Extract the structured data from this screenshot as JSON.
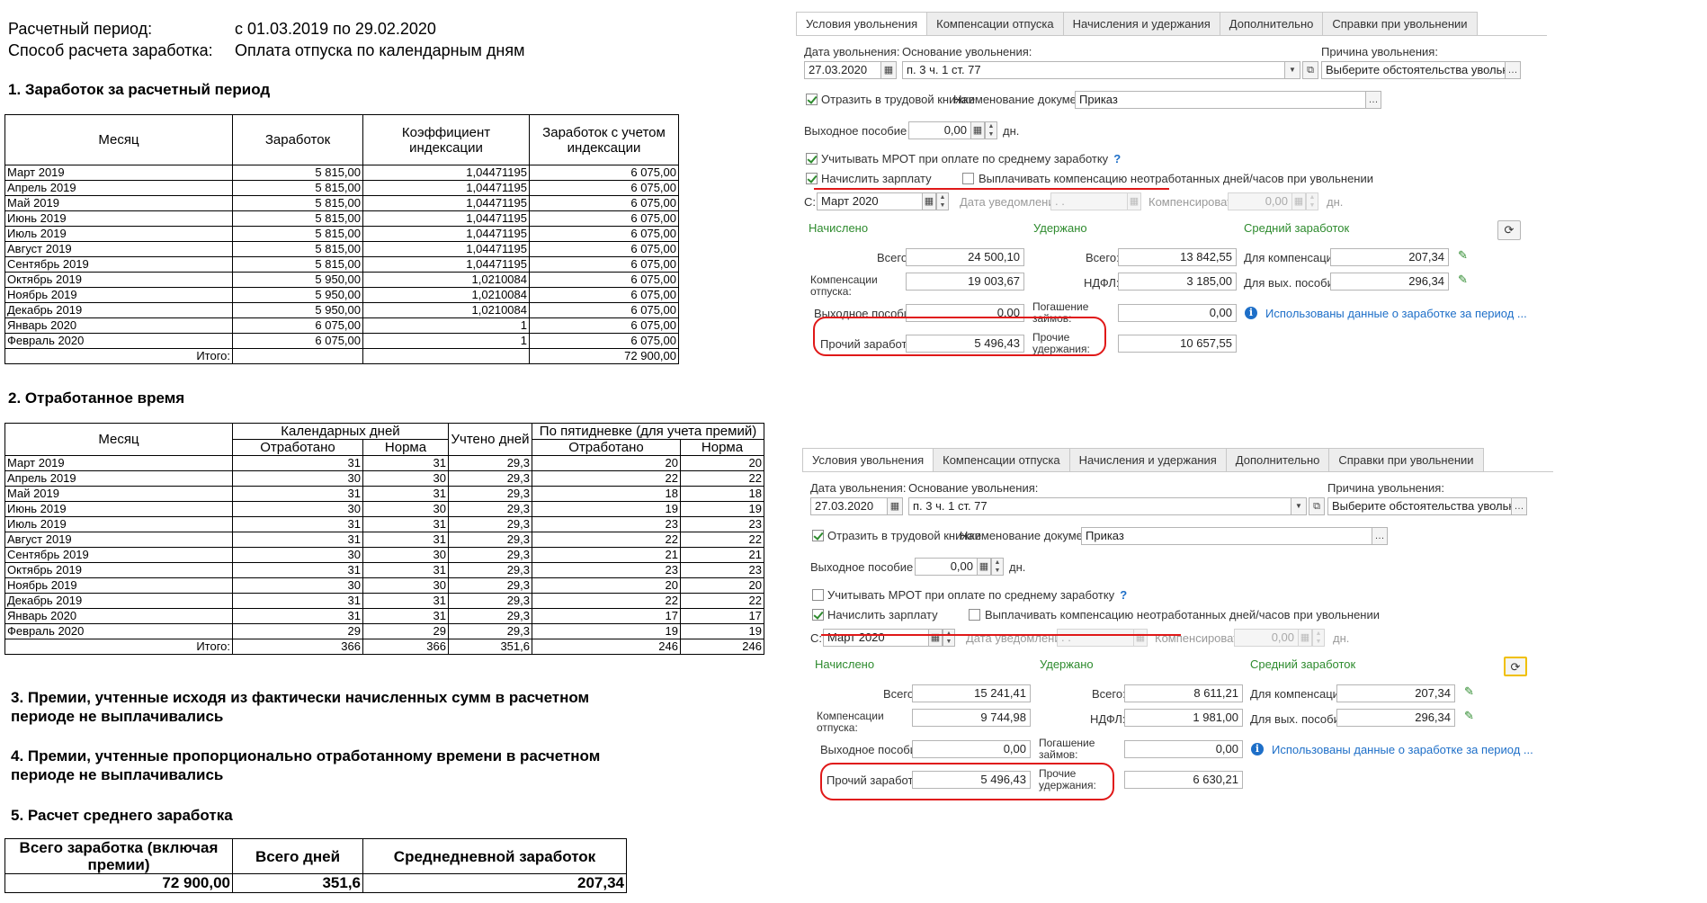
{
  "report": {
    "period_label": "Расчетный период:",
    "period_value": "с 01.03.2019 по 29.02.2020",
    "method_label": "Способ расчета заработка:",
    "method_value": "Оплата отпуска по календарным дням",
    "section1_title": "1. Заработок за расчетный период",
    "section2_title": "2. Отработанное время",
    "section3_title_line1": "3. Премии, учтенные исходя из фактически начисленных сумм в расчетном",
    "section3_title_line2": "периоде не выплачивались",
    "section4_title_line1": "4. Премии, учтенные пропорционально отработанному времени в расчетном",
    "section4_title_line2": "периоде не выплачивались",
    "section5_title": "5. Расчет среднего  заработка",
    "earnings_table": {
      "headers": [
        "Месяц",
        "Заработок",
        "Коэффициент индексации",
        "Заработок с учетом индексации"
      ],
      "rows": [
        [
          "Март 2019",
          "5 815,00",
          "1,04471195",
          "6 075,00"
        ],
        [
          "Апрель 2019",
          "5 815,00",
          "1,04471195",
          "6 075,00"
        ],
        [
          "Май 2019",
          "5 815,00",
          "1,04471195",
          "6 075,00"
        ],
        [
          "Июнь 2019",
          "5 815,00",
          "1,04471195",
          "6 075,00"
        ],
        [
          "Июль 2019",
          "5 815,00",
          "1,04471195",
          "6 075,00"
        ],
        [
          "Август 2019",
          "5 815,00",
          "1,04471195",
          "6 075,00"
        ],
        [
          "Сентябрь 2019",
          "5 815,00",
          "1,04471195",
          "6 075,00"
        ],
        [
          "Октябрь 2019",
          "5 950,00",
          "1,0210084",
          "6 075,00"
        ],
        [
          "Ноябрь 2019",
          "5 950,00",
          "1,0210084",
          "6 075,00"
        ],
        [
          "Декабрь 2019",
          "5 950,00",
          "1,0210084",
          "6 075,00"
        ],
        [
          "Январь 2020",
          "6 075,00",
          "1",
          "6 075,00"
        ],
        [
          "Февраль 2020",
          "6 075,00",
          "1",
          "6 075,00"
        ]
      ],
      "total_label": "Итого:",
      "total_value": "72 900,00"
    },
    "time_table": {
      "headers": {
        "month": "Месяц",
        "calendar_days": "Календарных дней",
        "counted_days": "Учтено дней",
        "five_day": "По пятидневке (для учета премий)",
        "worked": "Отработано",
        "norm": "Норма"
      },
      "rows": [
        [
          "Март 2019",
          "31",
          "31",
          "29,3",
          "20",
          "20"
        ],
        [
          "Апрель 2019",
          "30",
          "30",
          "29,3",
          "22",
          "22"
        ],
        [
          "Май 2019",
          "31",
          "31",
          "29,3",
          "18",
          "18"
        ],
        [
          "Июнь 2019",
          "30",
          "30",
          "29,3",
          "19",
          "19"
        ],
        [
          "Июль 2019",
          "31",
          "31",
          "29,3",
          "23",
          "23"
        ],
        [
          "Август 2019",
          "31",
          "31",
          "29,3",
          "22",
          "22"
        ],
        [
          "Сентябрь 2019",
          "30",
          "30",
          "29,3",
          "21",
          "21"
        ],
        [
          "Октябрь 2019",
          "31",
          "31",
          "29,3",
          "23",
          "23"
        ],
        [
          "Ноябрь 2019",
          "30",
          "30",
          "29,3",
          "20",
          "20"
        ],
        [
          "Декабрь 2019",
          "31",
          "31",
          "29,3",
          "22",
          "22"
        ],
        [
          "Январь 2020",
          "31",
          "31",
          "29,3",
          "17",
          "17"
        ],
        [
          "Февраль 2020",
          "29",
          "29",
          "29,3",
          "19",
          "19"
        ]
      ],
      "total_label": "Итого:",
      "totals": [
        "366",
        "366",
        "351,6",
        "246",
        "246"
      ]
    },
    "avg_table": {
      "headers": [
        "Всего заработка (включая премии)",
        "Всего дней",
        "Среднедневной заработок"
      ],
      "values": [
        "72 900,00",
        "351,6",
        "207,34"
      ]
    }
  },
  "forms": [
    {
      "tabs": [
        "Условия увольнения",
        "Компенсации отпуска",
        "Начисления и удержания",
        "Дополнительно",
        "Справки при увольнении"
      ],
      "dismissal_date_label": "Дата увольнения:",
      "dismissal_date": "27.03.2020",
      "basis_label": "Основание увольнения:",
      "basis_value": "п. 3 ч. 1 ст. 77",
      "reason_label": "Причина увольнения:",
      "reason_value": "Выберите обстоятельства увольнения...",
      "labor_book_label": "Отразить в трудовой книжке",
      "doc_name_label": "Наименование документа:",
      "doc_name_value": "Приказ",
      "severance_label": "Выходное пособие за:",
      "severance_value": "0,00",
      "days_unit": "дн.",
      "mrot_label": "Учитывать МРОТ при оплате по среднему заработку",
      "mrot_help": "?",
      "mrot_checked": true,
      "salary_label": "Начислить зарплату",
      "pay_comp_label": "Выплачивать компенсацию неотработанных дней/часов при увольнении",
      "from_label": "С:",
      "from_value": "Март 2020",
      "notice_label": "Дата уведомления:",
      "notice_value": " .  .",
      "compensate_label": "Компенсировать:",
      "compensate_value": "0,00",
      "accrued_header": "Начислено",
      "withheld_header": "Удержано",
      "avg_header": "Средний заработок",
      "total_label": "Всего:",
      "accrued_total": "24 500,10",
      "vacation_comp_label_1": "Компенсации",
      "vacation_comp_label_2": "отпуска:",
      "vacation_comp_value": "19 003,67",
      "severance_pay_label": "Выходное пособие:",
      "severance_pay_value": "0,00",
      "other_earnings_label": "Прочий заработок:",
      "other_earnings_value": "5 496,43",
      "withheld_total_label": "Всего:",
      "withheld_total": "13 842,55",
      "ndfl_label": "НДФЛ:",
      "ndfl_value": "3 185,00",
      "loans_label_1": "Погашение",
      "loans_label_2": "займов:",
      "loans_value": "0,00",
      "other_withheld_label_1": "Прочие",
      "other_withheld_label_2": "удержания:",
      "other_withheld_value": "10 657,55",
      "avg_comp_label": "Для компенсаций:",
      "avg_comp_value": "207,34",
      "avg_sev_label": "Для вых. пособия:",
      "avg_sev_value": "296,34",
      "info_text": "Использованы данные о заработке за период ..."
    },
    {
      "tabs": [
        "Условия увольнения",
        "Компенсации отпуска",
        "Начисления и удержания",
        "Дополнительно",
        "Справки при увольнении"
      ],
      "dismissal_date_label": "Дата увольнения:",
      "dismissal_date": "27.03.2020",
      "basis_label": "Основание увольнения:",
      "basis_value": "п. 3 ч. 1 ст. 77",
      "reason_label": "Причина увольнения:",
      "reason_value": "Выберите обстоятельства увольнения...",
      "labor_book_label": "Отразить в трудовой книжке",
      "doc_name_label": "Наименование документа:",
      "doc_name_value": "Приказ",
      "severance_label": "Выходное пособие за:",
      "severance_value": "0,00",
      "days_unit": "дн.",
      "mrot_label": "Учитывать МРОТ при оплате по среднему заработку",
      "mrot_help": "?",
      "mrot_checked": false,
      "salary_label": "Начислить зарплату",
      "pay_comp_label": "Выплачивать компенсацию неотработанных дней/часов при увольнении",
      "from_label": "С:",
      "from_value": "Март 2020",
      "notice_label": "Дата уведомления:",
      "notice_value": " .  .",
      "compensate_label": "Компенсировать:",
      "compensate_value": "0,00",
      "accrued_header": "Начислено",
      "withheld_header": "Удержано",
      "avg_header": "Средний заработок",
      "total_label": "Всего:",
      "accrued_total": "15 241,41",
      "vacation_comp_label_1": "Компенсации",
      "vacation_comp_label_2": "отпуска:",
      "vacation_comp_value": "9 744,98",
      "severance_pay_label": "Выходное пособие:",
      "severance_pay_value": "0,00",
      "other_earnings_label": "Прочий заработок:",
      "other_earnings_value": "5 496,43",
      "withheld_total_label": "Всего:",
      "withheld_total": "8 611,21",
      "ndfl_label": "НДФЛ:",
      "ndfl_value": "1 981,00",
      "loans_label_1": "Погашение",
      "loans_label_2": "займов:",
      "loans_value": "0,00",
      "other_withheld_label_1": "Прочие",
      "other_withheld_label_2": "удержания:",
      "other_withheld_value": "6 630,21",
      "avg_comp_label": "Для компенсаций:",
      "avg_comp_value": "207,34",
      "avg_sev_label": "Для вых. пособия:",
      "avg_sev_value": "296,34",
      "info_text": "Использованы данные о заработке за период ..."
    }
  ],
  "icons": {
    "calendar": "calendar-icon",
    "dropdown": "chevron-down-icon",
    "open": "open-icon",
    "refresh": "refresh-icon",
    "edit": "pencil-icon",
    "info": "info-icon"
  },
  "colors": {
    "highlight_red": "#e01818",
    "check_green": "#2e8b2e",
    "link_blue": "#1e6fc8"
  }
}
